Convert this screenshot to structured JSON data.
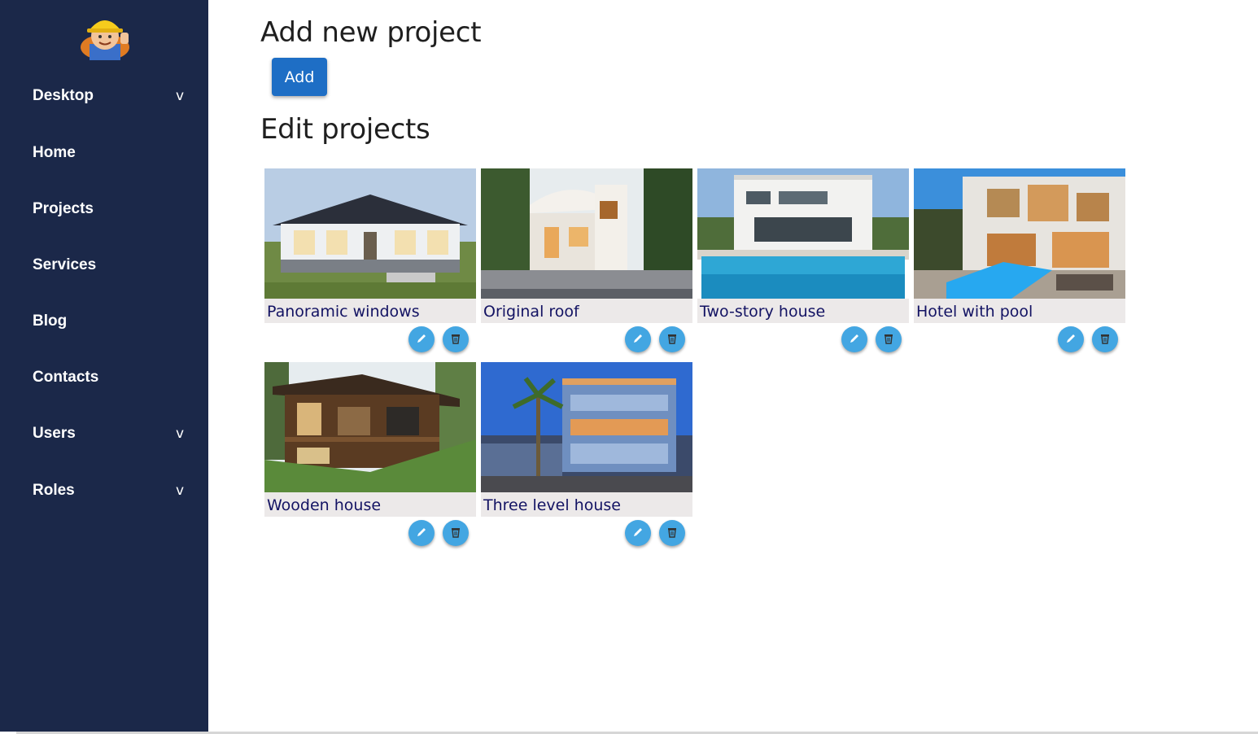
{
  "sidebar": {
    "items": [
      {
        "label": "Desktop",
        "chevron": "v"
      },
      {
        "label": "Home",
        "chevron": ""
      },
      {
        "label": "Projects",
        "chevron": ""
      },
      {
        "label": "Services",
        "chevron": ""
      },
      {
        "label": "Blog",
        "chevron": ""
      },
      {
        "label": "Contacts",
        "chevron": ""
      },
      {
        "label": "Users",
        "chevron": "v"
      },
      {
        "label": "Roles",
        "chevron": "v"
      }
    ],
    "background": "#1b2849"
  },
  "add_section": {
    "title": "Add new project",
    "button_label": "Add"
  },
  "edit_section": {
    "title": "Edit projects"
  },
  "projects": [
    {
      "title": "Panoramic windows",
      "image": "white-house-photo"
    },
    {
      "title": "Original roof",
      "image": "modern-house-photo"
    },
    {
      "title": "Two-story house",
      "image": "pool-house-photo"
    },
    {
      "title": "Hotel with pool",
      "image": "hotel-pool-photo"
    },
    {
      "title": "Wooden house",
      "image": "wooden-house-photo"
    },
    {
      "title": "Three level house",
      "image": "office-building-photo"
    }
  ],
  "colors": {
    "accent": "#1e6ec5",
    "icon_button": "#43a6e2",
    "caption_text": "#131363",
    "caption_bg": "#ece9e9"
  }
}
